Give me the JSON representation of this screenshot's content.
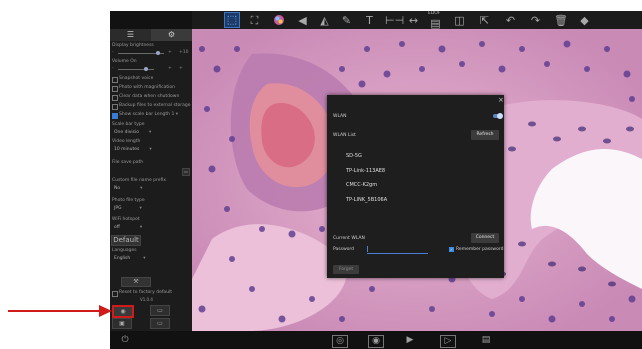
{
  "toolbar": {
    "icons": [
      "select-icon",
      "crop-icon",
      "color-icon",
      "cursor-icon",
      "measure-icon",
      "pen-icon",
      "text-icon",
      "hruler-icon",
      "hruler2-icon",
      "edof-icon",
      "split-icon",
      "pointer-icon",
      "undo-icon",
      "redo-icon",
      "delete-icon",
      "eraser-icon"
    ],
    "edof_label": "EDOF"
  },
  "panel": {
    "display_brightness": "Display brightness",
    "volume": "Volume",
    "volume_value": "On",
    "snapshot_voice": "Snapshot voice",
    "photo_magnification": "Photo with magnification",
    "clear_data": "Clear data when shutdown",
    "backup_files": "Backup files to external storage",
    "show_scale_bar": "Show scale bar",
    "length_label": "Length",
    "length_value": "1",
    "scale_bar_type": "Scale bar type",
    "scale_bar_type_value": "One divisio",
    "video_length": "Video length",
    "video_length_value": "10 minutes",
    "file_save_path": "File save path",
    "custom_prefix": "Custom file name prefix",
    "custom_prefix_value": "No",
    "photo_file_type": "Photo file type",
    "photo_file_type_value": "JPG",
    "wifi_hotspot": "WiFi hotspot",
    "wifi_hotspot_value": "off",
    "default_btn": "Default",
    "languages": "Languages",
    "languages_value": "English",
    "reset_factory": "Reset to factory default",
    "version": "V1.0.4"
  },
  "dialog": {
    "wlan_label": "WLAN",
    "wlan_list_label": "WLAN List",
    "refresh": "Refresh",
    "networks": [
      "SD-5G",
      "TP-Link-113AE8",
      "CMCC-K2gm",
      "TP-LINK_5B106A"
    ],
    "current_wlan": "Current WLAN",
    "connect": "Connect",
    "password_label": "Password",
    "remember_password": "Remember password",
    "forget": "Forget",
    "close_glyph": "×"
  },
  "colors": {
    "accent": "#3a7bd5",
    "highlight": "#d11a1a"
  }
}
